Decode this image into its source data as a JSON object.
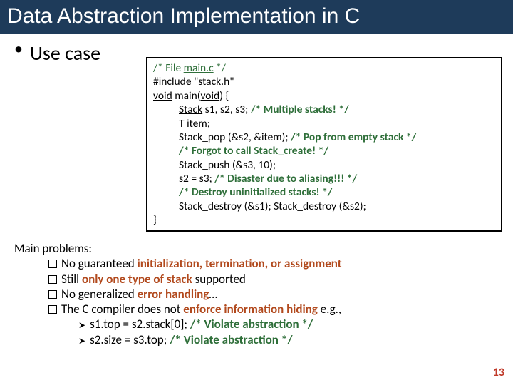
{
  "title": "Data Abstraction Implementation in C",
  "bullet": "Use case",
  "code": {
    "l1_a": "/* File ",
    "l1_b": "main.c",
    "l1_c": " */",
    "l2_a": "#include \"",
    "l2_b": "stack.h",
    "l2_c": "\"",
    "l3_a": "void",
    "l3_b": " main(",
    "l3_c": "void",
    "l3_d": ") {",
    "l4_a": "Stack",
    "l4_b": " s1, s2, s3; ",
    "l4_c": "/* Multiple stacks! */",
    "l5_a": "T",
    "l5_b": " item;",
    "l6_a": "Stack_pop (&s2, &item); ",
    "l6_b": "/* Pop from empty stack */",
    "l7": "/* Forgot to call Stack_create! */",
    "l8": "Stack_push (&s3, 10);",
    "l9_a": "s2 = s3; ",
    "l9_b": "/* Disaster due to aliasing!!! */",
    "l10": "/* Destroy uninitialized stacks! */",
    "l11": "Stack_destroy (&s1); Stack_destroy (&s2);",
    "l12": "}"
  },
  "lower": {
    "intro": "Main problems:",
    "q1_a": "No guaranteed ",
    "q1_b": "initialization, termination, or assignment",
    "q2_a": "Still ",
    "q2_b": "only one type of stack",
    "q2_c": " supported",
    "q3_a": "No generalized ",
    "q3_b": "error handling",
    "q3_c": "…",
    "q4_a": "The C compiler does not ",
    "q4_b": "enforce information hiding",
    "q4_c": " e.g.,",
    "a1_a": "s1.top = s2.stack[0]; ",
    "a1_b": "/* Violate abstraction */",
    "a2_a": "s2.size = s3.top; ",
    "a2_b": "/* Violate abstraction */"
  },
  "page": "13"
}
